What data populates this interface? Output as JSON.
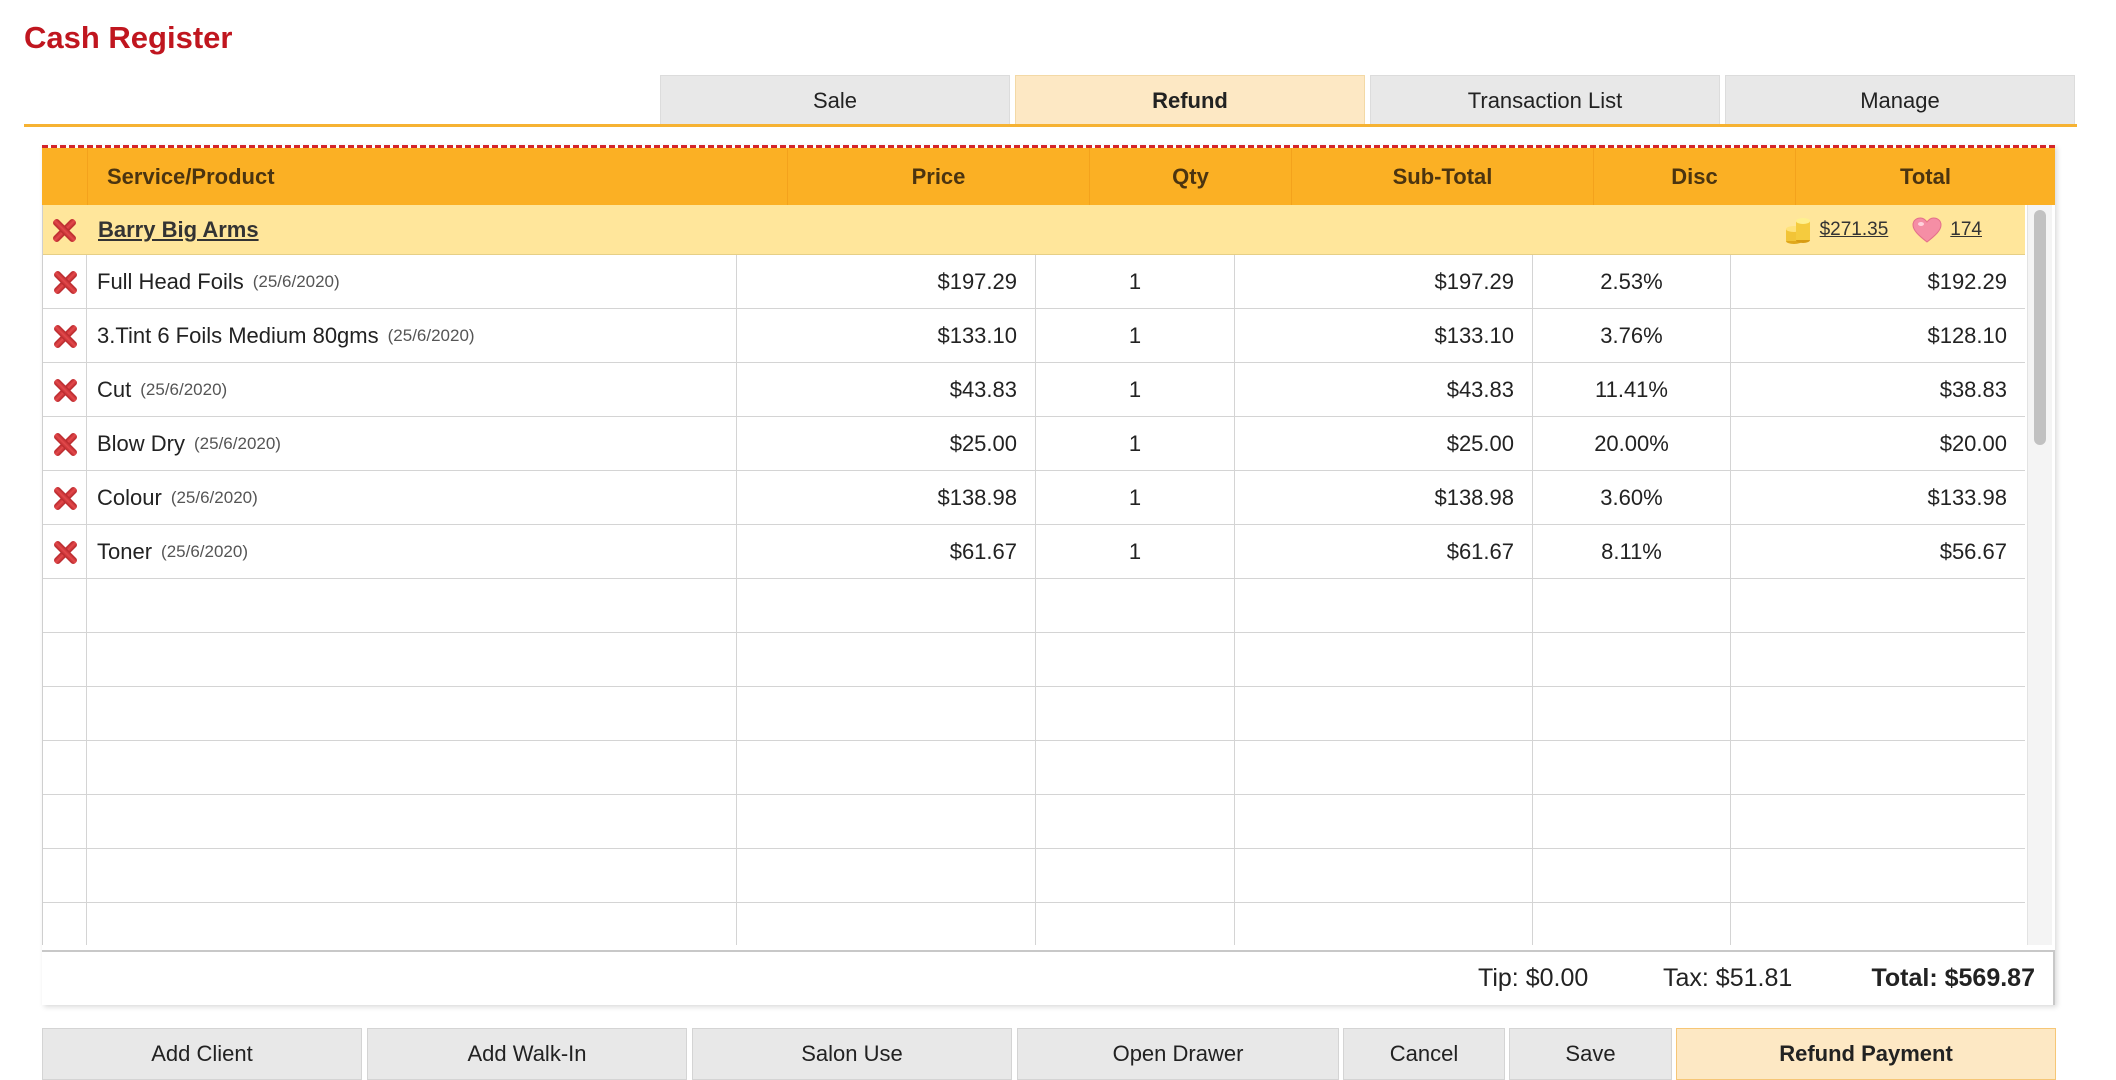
{
  "app": {
    "title": "Cash Register"
  },
  "tabs": [
    {
      "label": "Sale",
      "active": false
    },
    {
      "label": "Refund",
      "active": true
    },
    {
      "label": "Transaction List",
      "active": false
    },
    {
      "label": "Manage",
      "active": false
    }
  ],
  "table": {
    "columns": [
      "Service/Product",
      "Price",
      "Qty",
      "Sub-Total",
      "Disc",
      "Total"
    ],
    "client": {
      "name": "Barry Big Arms",
      "balance": "$271.35",
      "points": "174",
      "balance_icon": "coins-icon",
      "points_icon": "heart-icon"
    },
    "rows": [
      {
        "name": "Full Head Foils",
        "date": "(25/6/2020)",
        "price": "$197.29",
        "qty": "1",
        "subtotal": "$197.29",
        "disc": "2.53%",
        "total": "$192.29"
      },
      {
        "name": "3.Tint 6 Foils Medium 80gms",
        "date": "(25/6/2020)",
        "price": "$133.10",
        "qty": "1",
        "subtotal": "$133.10",
        "disc": "3.76%",
        "total": "$128.10"
      },
      {
        "name": "Cut",
        "date": "(25/6/2020)",
        "price": "$43.83",
        "qty": "1",
        "subtotal": "$43.83",
        "disc": "11.41%",
        "total": "$38.83"
      },
      {
        "name": "Blow Dry",
        "date": "(25/6/2020)",
        "price": "$25.00",
        "qty": "1",
        "subtotal": "$25.00",
        "disc": "20.00%",
        "total": "$20.00"
      },
      {
        "name": "Colour",
        "date": "(25/6/2020)",
        "price": "$138.98",
        "qty": "1",
        "subtotal": "$138.98",
        "disc": "3.60%",
        "total": "$133.98"
      },
      {
        "name": "Toner",
        "date": "(25/6/2020)",
        "price": "$61.67",
        "qty": "1",
        "subtotal": "$61.67",
        "disc": "8.11%",
        "total": "$56.67"
      }
    ]
  },
  "totals": {
    "tip": "Tip: $0.00",
    "tax": "Tax: $51.81",
    "total": "Total: $569.87"
  },
  "buttons": {
    "add_client": "Add Client",
    "add_walkin": "Add Walk-In",
    "salon_use": "Salon Use",
    "open_drawer": "Open Drawer",
    "cancel": "Cancel",
    "save": "Save",
    "refund_payment": "Refund Payment"
  },
  "colors": {
    "title": "#c0161f",
    "header_bg": "#fbb024",
    "client_row_bg": "#ffe69b",
    "active_tab_bg": "#fde8c4",
    "remove_icon": "#d2252b"
  }
}
